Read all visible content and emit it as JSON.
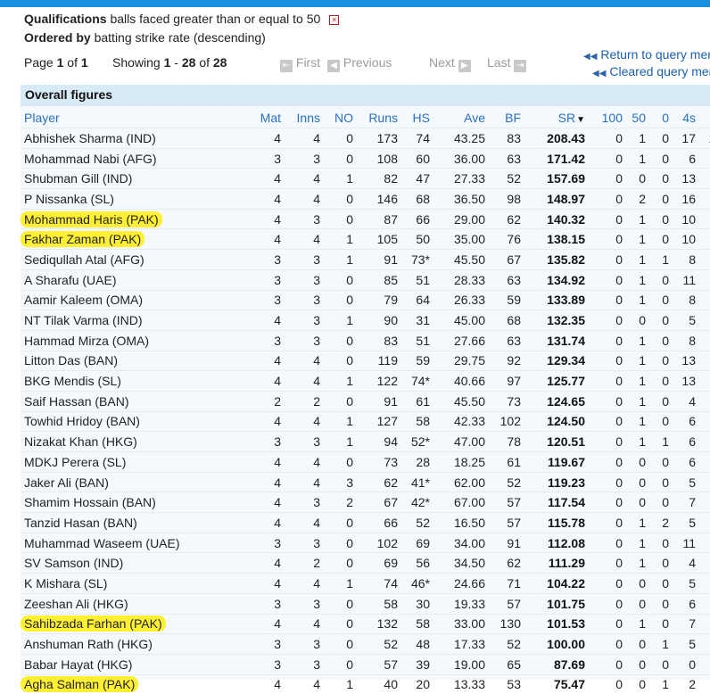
{
  "header": {
    "qual_label": "Qualifications",
    "qual_text": "balls faced greater than or equal to 50",
    "remove_icon": "x-box-icon",
    "order_label": "Ordered by",
    "order_text": "batting strike rate (descending)"
  },
  "pagination": {
    "page_label": "Page",
    "page": "1",
    "of_label": "of",
    "pages": "1",
    "showing_label": "Showing",
    "from": "1",
    "dash": "-",
    "to": "28",
    "of2": "of",
    "total": "28",
    "first": "First",
    "previous": "Previous",
    "next": "Next",
    "last": "Last"
  },
  "links": {
    "return": "Return to query mer",
    "cleared": "Cleared query mer"
  },
  "panel_title": "Overall figures",
  "columns": [
    "Player",
    "Mat",
    "Inns",
    "NO",
    "Runs",
    "HS",
    "Ave",
    "BF",
    "SR",
    "100",
    "50",
    "0",
    "4s",
    "6s"
  ],
  "sort_column": "SR",
  "highlight_color": "#fff033",
  "rows": [
    {
      "player": "Abhishek Sharma (IND)",
      "mat": "4",
      "inns": "4",
      "no": "0",
      "runs": "173",
      "hs": "74",
      "ave": "43.25",
      "bf": "83",
      "sr": "208.43",
      "h": "0",
      "f": "1",
      "z": "0",
      "fours": "17",
      "sixes": "12",
      "hl": false
    },
    {
      "player": "Mohammad Nabi (AFG)",
      "mat": "3",
      "inns": "3",
      "no": "0",
      "runs": "108",
      "hs": "60",
      "ave": "36.00",
      "bf": "63",
      "sr": "171.42",
      "h": "0",
      "f": "1",
      "z": "0",
      "fours": "6",
      "sixes": "8",
      "hl": false
    },
    {
      "player": "Shubman Gill (IND)",
      "mat": "4",
      "inns": "4",
      "no": "1",
      "runs": "82",
      "hs": "47",
      "ave": "27.33",
      "bf": "52",
      "sr": "157.69",
      "h": "0",
      "f": "0",
      "z": "0",
      "fours": "13",
      "sixes": "1",
      "hl": false
    },
    {
      "player": "P Nissanka (SL)",
      "mat": "4",
      "inns": "4",
      "no": "0",
      "runs": "146",
      "hs": "68",
      "ave": "36.50",
      "bf": "98",
      "sr": "148.97",
      "h": "0",
      "f": "2",
      "z": "0",
      "fours": "16",
      "sixes": "4",
      "hl": false
    },
    {
      "player": "Mohammad Haris (PAK)",
      "mat": "4",
      "inns": "3",
      "no": "0",
      "runs": "87",
      "hs": "66",
      "ave": "29.00",
      "bf": "62",
      "sr": "140.32",
      "h": "0",
      "f": "1",
      "z": "0",
      "fours": "10",
      "sixes": "3",
      "hl": true
    },
    {
      "player": "Fakhar Zaman (PAK)",
      "mat": "4",
      "inns": "4",
      "no": "1",
      "runs": "105",
      "hs": "50",
      "ave": "35.00",
      "bf": "76",
      "sr": "138.15",
      "h": "0",
      "f": "1",
      "z": "0",
      "fours": "10",
      "sixes": "3",
      "hl": true
    },
    {
      "player": "Sediqullah Atal (AFG)",
      "mat": "3",
      "inns": "3",
      "no": "1",
      "runs": "91",
      "hs": "73*",
      "ave": "45.50",
      "bf": "67",
      "sr": "135.82",
      "h": "0",
      "f": "1",
      "z": "1",
      "fours": "8",
      "sixes": "4",
      "hl": false
    },
    {
      "player": "A Sharafu (UAE)",
      "mat": "3",
      "inns": "3",
      "no": "0",
      "runs": "85",
      "hs": "51",
      "ave": "28.33",
      "bf": "63",
      "sr": "134.92",
      "h": "0",
      "f": "1",
      "z": "0",
      "fours": "11",
      "sixes": "3",
      "hl": false
    },
    {
      "player": "Aamir Kaleem (OMA)",
      "mat": "3",
      "inns": "3",
      "no": "0",
      "runs": "79",
      "hs": "64",
      "ave": "26.33",
      "bf": "59",
      "sr": "133.89",
      "h": "0",
      "f": "1",
      "z": "0",
      "fours": "8",
      "sixes": "3",
      "hl": false
    },
    {
      "player": "NT Tilak Varma (IND)",
      "mat": "4",
      "inns": "3",
      "no": "1",
      "runs": "90",
      "hs": "31",
      "ave": "45.00",
      "bf": "68",
      "sr": "132.35",
      "h": "0",
      "f": "0",
      "z": "0",
      "fours": "5",
      "sixes": "5",
      "hl": false
    },
    {
      "player": "Hammad Mirza (OMA)",
      "mat": "3",
      "inns": "3",
      "no": "0",
      "runs": "83",
      "hs": "51",
      "ave": "27.66",
      "bf": "63",
      "sr": "131.74",
      "h": "0",
      "f": "1",
      "z": "0",
      "fours": "8",
      "sixes": "3",
      "hl": false
    },
    {
      "player": "Litton Das (BAN)",
      "mat": "4",
      "inns": "4",
      "no": "0",
      "runs": "119",
      "hs": "59",
      "ave": "29.75",
      "bf": "92",
      "sr": "129.34",
      "h": "0",
      "f": "1",
      "z": "0",
      "fours": "13",
      "sixes": "1",
      "hl": false
    },
    {
      "player": "BKG Mendis (SL)",
      "mat": "4",
      "inns": "4",
      "no": "1",
      "runs": "122",
      "hs": "74*",
      "ave": "40.66",
      "bf": "97",
      "sr": "125.77",
      "h": "0",
      "f": "1",
      "z": "0",
      "fours": "13",
      "sixes": "3",
      "hl": false
    },
    {
      "player": "Saif Hassan (BAN)",
      "mat": "2",
      "inns": "2",
      "no": "0",
      "runs": "91",
      "hs": "61",
      "ave": "45.50",
      "bf": "73",
      "sr": "124.65",
      "h": "0",
      "f": "1",
      "z": "0",
      "fours": "4",
      "sixes": "5",
      "hl": false
    },
    {
      "player": "Towhid Hridoy (BAN)",
      "mat": "4",
      "inns": "4",
      "no": "1",
      "runs": "127",
      "hs": "58",
      "ave": "42.33",
      "bf": "102",
      "sr": "124.50",
      "h": "0",
      "f": "1",
      "z": "0",
      "fours": "6",
      "sixes": "3",
      "hl": false
    },
    {
      "player": "Nizakat Khan (HKG)",
      "mat": "3",
      "inns": "3",
      "no": "1",
      "runs": "94",
      "hs": "52*",
      "ave": "47.00",
      "bf": "78",
      "sr": "120.51",
      "h": "0",
      "f": "1",
      "z": "1",
      "fours": "6",
      "sixes": "3",
      "hl": false
    },
    {
      "player": "MDKJ Perera (SL)",
      "mat": "4",
      "inns": "4",
      "no": "0",
      "runs": "73",
      "hs": "28",
      "ave": "18.25",
      "bf": "61",
      "sr": "119.67",
      "h": "0",
      "f": "0",
      "z": "0",
      "fours": "6",
      "sixes": "1",
      "hl": false
    },
    {
      "player": "Jaker Ali (BAN)",
      "mat": "4",
      "inns": "4",
      "no": "3",
      "runs": "62",
      "hs": "41*",
      "ave": "62.00",
      "bf": "52",
      "sr": "119.23",
      "h": "0",
      "f": "0",
      "z": "0",
      "fours": "5",
      "sixes": "0",
      "hl": false
    },
    {
      "player": "Shamim Hossain (BAN)",
      "mat": "4",
      "inns": "3",
      "no": "2",
      "runs": "67",
      "hs": "42*",
      "ave": "67.00",
      "bf": "57",
      "sr": "117.54",
      "h": "0",
      "f": "0",
      "z": "0",
      "fours": "7",
      "sixes": "1",
      "hl": false
    },
    {
      "player": "Tanzid Hasan (BAN)",
      "mat": "4",
      "inns": "4",
      "no": "0",
      "runs": "66",
      "hs": "52",
      "ave": "16.50",
      "bf": "57",
      "sr": "115.78",
      "h": "0",
      "f": "1",
      "z": "2",
      "fours": "5",
      "sixes": "3",
      "hl": false
    },
    {
      "player": "Muhammad Waseem (UAE)",
      "mat": "3",
      "inns": "3",
      "no": "0",
      "runs": "102",
      "hs": "69",
      "ave": "34.00",
      "bf": "91",
      "sr": "112.08",
      "h": "0",
      "f": "1",
      "z": "0",
      "fours": "11",
      "sixes": "3",
      "hl": false
    },
    {
      "player": "SV Samson (IND)",
      "mat": "4",
      "inns": "2",
      "no": "0",
      "runs": "69",
      "hs": "56",
      "ave": "34.50",
      "bf": "62",
      "sr": "111.29",
      "h": "0",
      "f": "1",
      "z": "0",
      "fours": "4",
      "sixes": "3",
      "hl": false
    },
    {
      "player": "K Mishara (SL)",
      "mat": "4",
      "inns": "4",
      "no": "1",
      "runs": "74",
      "hs": "46*",
      "ave": "24.66",
      "bf": "71",
      "sr": "104.22",
      "h": "0",
      "f": "0",
      "z": "0",
      "fours": "5",
      "sixes": "3",
      "hl": false
    },
    {
      "player": "Zeeshan Ali (HKG)",
      "mat": "3",
      "inns": "3",
      "no": "0",
      "runs": "58",
      "hs": "30",
      "ave": "19.33",
      "bf": "57",
      "sr": "101.75",
      "h": "0",
      "f": "0",
      "z": "0",
      "fours": "6",
      "sixes": "1",
      "hl": false
    },
    {
      "player": "Sahibzada Farhan (PAK)",
      "mat": "4",
      "inns": "4",
      "no": "0",
      "runs": "132",
      "hs": "58",
      "ave": "33.00",
      "bf": "130",
      "sr": "101.53",
      "h": "0",
      "f": "1",
      "z": "0",
      "fours": "7",
      "sixes": "6",
      "hl": true
    },
    {
      "player": "Anshuman Rath (HKG)",
      "mat": "3",
      "inns": "3",
      "no": "0",
      "runs": "52",
      "hs": "48",
      "ave": "17.33",
      "bf": "52",
      "sr": "100.00",
      "h": "0",
      "f": "0",
      "z": "1",
      "fours": "5",
      "sixes": "0",
      "hl": false
    },
    {
      "player": "Babar Hayat (HKG)",
      "mat": "3",
      "inns": "3",
      "no": "0",
      "runs": "57",
      "hs": "39",
      "ave": "19.00",
      "bf": "65",
      "sr": "87.69",
      "h": "0",
      "f": "0",
      "z": "0",
      "fours": "0",
      "sixes": "4",
      "hl": false
    },
    {
      "player": "Agha Salman (PAK)",
      "mat": "4",
      "inns": "4",
      "no": "1",
      "runs": "40",
      "hs": "20",
      "ave": "13.33",
      "bf": "53",
      "sr": "75.47",
      "h": "0",
      "f": "0",
      "z": "1",
      "fours": "2",
      "sixes": "1",
      "hl": true
    }
  ]
}
